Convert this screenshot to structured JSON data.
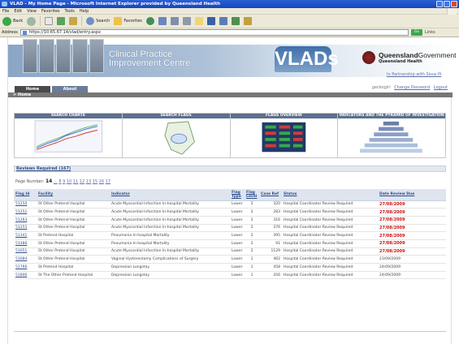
{
  "window": {
    "title": "VLAD - My Home Page - Microsoft Internet Explorer provided by Queensland Health"
  },
  "menu": [
    "File",
    "Edit",
    "View",
    "Favorites",
    "Tools",
    "Help"
  ],
  "toolbar": {
    "back_label": "Back",
    "search_label": "Search",
    "favorites_label": "Favorites"
  },
  "address": {
    "label": "Address",
    "url": "https://10.65.67.14/vlad/entry.aspx",
    "go_label": "Go",
    "links_label": "Links"
  },
  "banner": {
    "title_line1": "Clinical Practice",
    "title_line2": "Improvement Centre",
    "vlads": "VLADs",
    "qh_bold": "Queensland",
    "qh_light": "Government",
    "qh_health": "Queensland Health",
    "partnership": "In Partnership with Sisus Pi"
  },
  "nav": {
    "tabs": [
      "Home",
      "About"
    ],
    "username": "geckogirl",
    "change_password": "Change Password",
    "logout": "Logout",
    "breadcrumb": "> Home"
  },
  "panels": [
    "SEARCH CHARTS",
    "SEARCH FLAGS",
    "FLAGS OVERVIEW",
    "INDICATORS AND THE PYRAMID OF INVESTIGATION"
  ],
  "reviews": {
    "heading": "Reviews Required (167)",
    "page_label": "Page Number:",
    "current_page": "14",
    "page_links": [
      "...",
      "8",
      "9",
      "10",
      "11",
      "12",
      "13",
      "15",
      "16",
      "17"
    ],
    "columns": [
      "Flag Id",
      "Facility",
      "Indicator",
      "Flag Type",
      "Flag Level",
      "Case Ref",
      "Status",
      "Date Review Due"
    ],
    "rows": [
      {
        "id": "51250",
        "facility": "St Other Pretend Hospital",
        "indicator": "Acute Myocardial Infarction In-hospital Mortality",
        "type": "Lower",
        "level": "2",
        "case": "320",
        "status": "Hospital Coordinator Review Required",
        "due": "27/08/2009",
        "overdue": true
      },
      {
        "id": "51251",
        "facility": "St Other Pretend Hospital",
        "indicator": "Acute Myocardial Infarction In-hospital Mortality",
        "type": "Lower",
        "level": "2",
        "case": "283",
        "status": "Hospital Coordinator Review Required",
        "due": "27/08/2009",
        "overdue": true
      },
      {
        "id": "51263",
        "facility": "St Other Pretend Hospital",
        "indicator": "Acute Myocardial Infarction In-hospital Mortality",
        "type": "Lower",
        "level": "2",
        "case": "316",
        "status": "Hospital Coordinator Review Required",
        "due": "27/08/2009",
        "overdue": true
      },
      {
        "id": "51255",
        "facility": "St Other Pretend Hospital",
        "indicator": "Acute Myocardial Infarction In-hospital Mortality",
        "type": "Lower",
        "level": "2",
        "case": "376",
        "status": "Hospital Coordinator Review Required",
        "due": "27/08/2009",
        "overdue": true
      },
      {
        "id": "51341",
        "facility": "St Pretend Hospital",
        "indicator": "Pneumonia In-hospital Mortality",
        "type": "Lower",
        "level": "2",
        "case": "395",
        "status": "Hospital Coordinator Review Required",
        "due": "27/08/2009",
        "overdue": true
      },
      {
        "id": "51486",
        "facility": "St Other Pretend Hospital",
        "indicator": "Pneumonia In-hospital Mortality",
        "type": "Lower",
        "level": "2",
        "case": "91",
        "status": "Hospital Coordinator Review Required",
        "due": "27/08/2009",
        "overdue": true
      },
      {
        "id": "51651",
        "facility": "St Other Pretend Hospital",
        "indicator": "Acute Myocardial Infarction In-hospital Mortality",
        "type": "Lower",
        "level": "2",
        "case": "1129",
        "status": "Hospital Coordinator Review Required",
        "due": "27/08/2009",
        "overdue": true
      },
      {
        "id": "51684",
        "facility": "St Other Pretend Hospital",
        "indicator": "Vaginal Hysterectomy Complications of Surgery",
        "type": "Lower",
        "level": "1",
        "case": "462",
        "status": "Hospital Coordinator Review Required",
        "due": "23/09/2009",
        "overdue": false
      },
      {
        "id": "51766",
        "facility": "St Pretend Hospital",
        "indicator": "Depression Longstay",
        "type": "Lower",
        "level": "1",
        "case": "458",
        "status": "Hospital Coordinator Review Required",
        "due": "24/09/2009",
        "overdue": false
      },
      {
        "id": "51846",
        "facility": "St The Other Pretend Hospital",
        "indicator": "Depression Longstay",
        "type": "Lower",
        "level": "1",
        "case": "356",
        "status": "Hospital Coordinator Review Required",
        "due": "24/09/2009",
        "overdue": false
      }
    ]
  }
}
